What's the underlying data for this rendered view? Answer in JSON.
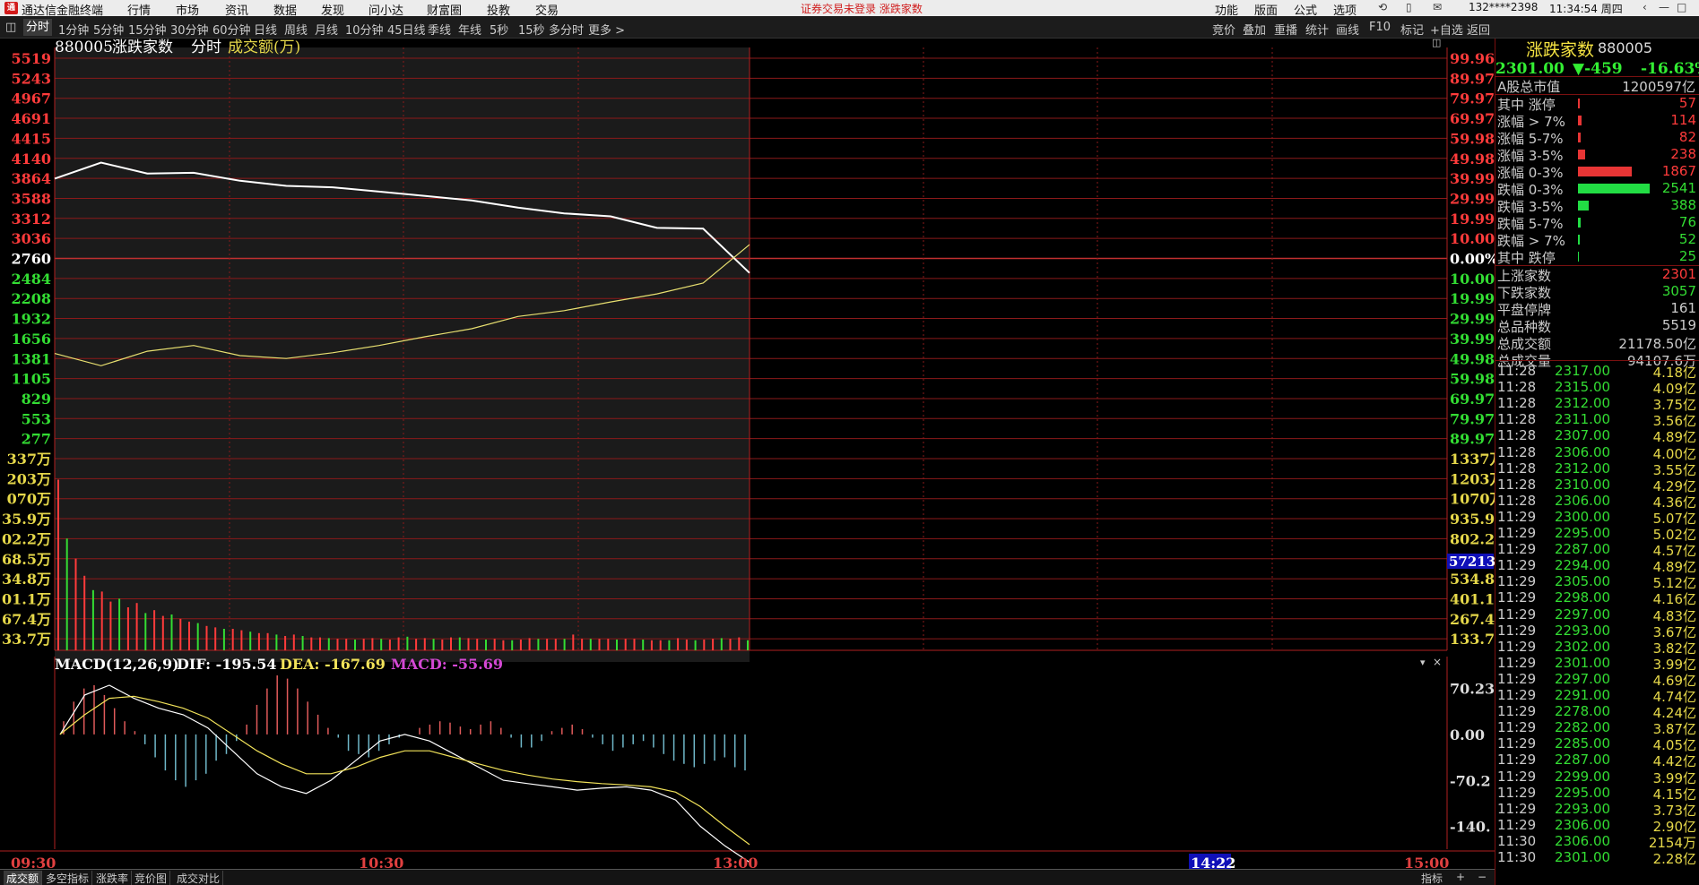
{
  "titlebar": {
    "app_name": "通达信金融终端",
    "menus": [
      "行情",
      "市场",
      "资讯",
      "数据",
      "发现",
      "问小达",
      "财富圈",
      "投教",
      "交易"
    ],
    "notice": "证券交易未登录  涨跌家数",
    "right_menus": [
      "功能",
      "版面",
      "公式",
      "选项"
    ],
    "account": "132****2398",
    "clock": "11:34:54 周四"
  },
  "toolbar": {
    "periods": [
      "分时",
      "1分钟",
      "5分钟",
      "15分钟",
      "30分钟",
      "60分钟",
      "日线",
      "周线",
      "月线",
      "10分钟",
      "45日线",
      "季线",
      "年线",
      "5秒",
      "15秒",
      "多分时",
      "更多 >"
    ],
    "active": "分时",
    "right_items": [
      "竞价",
      "叠加",
      "重播",
      "统计",
      "画线",
      "F10",
      "标记",
      "+自选",
      "返回"
    ]
  },
  "chart_header": {
    "code": "880005",
    "name": "涨跌家数",
    "period": "分时",
    "indicator": "成交额(万)"
  },
  "price_axis_left": [
    "5519",
    "5243",
    "4967",
    "4691",
    "4415",
    "4140",
    "3864",
    "3588",
    "3312",
    "3036",
    "2760",
    "2484",
    "2208",
    "1932",
    "1656",
    "1381",
    "1105",
    "829",
    "553",
    "277"
  ],
  "price_axis_right": [
    "99.96",
    "89.97",
    "79.97",
    "69.97",
    "59.98",
    "49.98",
    "39.99",
    "29.99",
    "19.99",
    "10.00",
    "0.00%",
    "10.00",
    "19.99",
    "29.99",
    "39.99",
    "49.98",
    "59.98",
    "69.97",
    "79.97",
    "89.97"
  ],
  "volume_axis_left": [
    "337万",
    "203万",
    "070万",
    "35.9万",
    "02.2万",
    "68.5万",
    "34.8万",
    "01.1万",
    "67.4万",
    "33.7万"
  ],
  "volume_axis_right": [
    "1337万",
    "1203万",
    "1070万",
    "935.9",
    "802.2",
    "668.5",
    "534.8",
    "401.1",
    "267.4",
    "133.7"
  ],
  "volume_cursor": "57213",
  "macd": {
    "label": "MACD(12,26,9)",
    "dif": "DIF: -195.54",
    "dea": "DEA: -167.69",
    "macd": "MACD: -55.69",
    "axis": [
      "70.23",
      "0.00",
      "-70.2",
      "-140."
    ]
  },
  "time_axis": [
    "09:30",
    "10:30",
    "13:00",
    "14:22",
    "15:00"
  ],
  "bottom_tabs": [
    "成交额",
    "多空指标",
    "涨跌率",
    "竞价图",
    "成交对比"
  ],
  "bottom_right": [
    "指标",
    "+",
    "−"
  ],
  "colors": {
    "up": "#ff3b3b",
    "down": "#33dd33",
    "grid": "#8b1a1a",
    "white_line": "#ffffff",
    "yellow_line": "#e8e070"
  },
  "chart_data": [
    {
      "type": "line",
      "title": "涨跌家数 分时",
      "x": [
        "09:30",
        "10:30",
        "13:00",
        "15:00"
      ],
      "ylim": [
        0,
        5519
      ],
      "series": [
        {
          "values": [
            3860,
            4080,
            3930,
            3940,
            3830,
            3760,
            3740,
            3680,
            3620,
            3560,
            3460,
            3380,
            3340,
            3180,
            3170,
            2560
          ]
        },
        {
          "values": [
            1450,
            1280,
            1480,
            1560,
            1420,
            1380,
            1460,
            1560,
            1680,
            1790,
            1960,
            2040,
            2160,
            2270,
            2420,
            2950
          ]
        }
      ]
    },
    {
      "type": "bar",
      "title": "成交额(万)",
      "ylim": [
        0,
        1337
      ],
      "values": [
        1190,
        780,
        640,
        520,
        420,
        410,
        340,
        360,
        300,
        330,
        260,
        280,
        240,
        250,
        220,
        200,
        190,
        170,
        160,
        150,
        150,
        140,
        130,
        120,
        120,
        110,
        100,
        110,
        100,
        90,
        90,
        85,
        80,
        80,
        75,
        80,
        85,
        80,
        75,
        90,
        95,
        80,
        85,
        80,
        75,
        90,
        90,
        85,
        80,
        75,
        80,
        70,
        70,
        75,
        85,
        80,
        80,
        80,
        80,
        110,
        80,
        80,
        80,
        80,
        75,
        80,
        80,
        75,
        70,
        70,
        70,
        85,
        75,
        70,
        75,
        80,
        85,
        80,
        90,
        70
      ]
    },
    {
      "type": "bar",
      "title": "MACD(12,26,9)",
      "ylim": [
        -175,
        105
      ],
      "values": [
        20,
        50,
        70,
        75,
        60,
        40,
        20,
        5,
        -15,
        -35,
        -55,
        -70,
        -80,
        -70,
        -60,
        -40,
        -30,
        -10,
        15,
        45,
        70,
        90,
        85,
        70,
        50,
        30,
        10,
        -5,
        -25,
        -30,
        -35,
        -25,
        -15,
        -5,
        0,
        10,
        15,
        20,
        18,
        12,
        8,
        15,
        20,
        10,
        -5,
        -20,
        -20,
        -10,
        5,
        10,
        15,
        8,
        -5,
        -15,
        -25,
        -20,
        -15,
        -10,
        -20,
        -30,
        -40,
        -45,
        -50,
        -45,
        -40,
        -35,
        -50,
        -55
      ],
      "series": [
        {
          "values": [
            0,
            60,
            75,
            55,
            40,
            30,
            10,
            -25,
            -60,
            -80,
            -90,
            -70,
            -40,
            -10,
            0,
            -10,
            -30,
            -50,
            -70,
            -75,
            -80,
            -85,
            -82,
            -80,
            -85,
            -100,
            -140,
            -170,
            -195
          ]
        },
        {
          "values": [
            0,
            30,
            55,
            58,
            50,
            40,
            25,
            0,
            -25,
            -45,
            -60,
            -60,
            -50,
            -35,
            -25,
            -25,
            -35,
            -45,
            -55,
            -62,
            -68,
            -72,
            -75,
            -77,
            -80,
            -88,
            -110,
            -140,
            -168
          ]
        }
      ]
    }
  ],
  "panel": {
    "title": "涨跌家数",
    "code": "880005",
    "price": "2301.00",
    "change": "▼-459",
    "pct": "-16.63%",
    "market_cap_label": "A股总市值",
    "market_cap": "1200597亿",
    "dist": [
      {
        "label": "其中 涨停",
        "value": "57",
        "bar": 2
      },
      {
        "label": "涨幅 > 7%",
        "value": "114",
        "bar": 4
      },
      {
        "label": "涨幅 5-7%",
        "value": "82",
        "bar": 3
      },
      {
        "label": "涨幅 3-5%",
        "value": "238",
        "bar": 8
      },
      {
        "label": "涨幅 0-3%",
        "value": "1867",
        "bar": 60
      },
      {
        "label": "跌幅 0-3%",
        "value": "2541",
        "bar": 80
      },
      {
        "label": "跌幅 3-5%",
        "value": "388",
        "bar": 12
      },
      {
        "label": "跌幅 5-7%",
        "value": "76",
        "bar": 3
      },
      {
        "label": "跌幅 > 7%",
        "value": "52",
        "bar": 2
      },
      {
        "label": "其中 跌停",
        "value": "25",
        "bar": 1
      }
    ],
    "stats": [
      {
        "label": "上涨家数",
        "value": "2301"
      },
      {
        "label": "下跌家数",
        "value": "3057"
      },
      {
        "label": "平盘停牌",
        "value": "161"
      },
      {
        "label": "总品种数",
        "value": "5519"
      },
      {
        "label": "总成交额",
        "value": "21178.50亿"
      },
      {
        "label": "总成交量",
        "value": "94107.6万"
      }
    ],
    "ticks": [
      [
        "11:28",
        "2317.00",
        "4.18亿"
      ],
      [
        "11:28",
        "2315.00",
        "4.09亿"
      ],
      [
        "11:28",
        "2312.00",
        "3.75亿"
      ],
      [
        "11:28",
        "2311.00",
        "3.56亿"
      ],
      [
        "11:28",
        "2307.00",
        "4.89亿"
      ],
      [
        "11:28",
        "2306.00",
        "4.00亿"
      ],
      [
        "11:28",
        "2312.00",
        "3.55亿"
      ],
      [
        "11:28",
        "2310.00",
        "4.29亿"
      ],
      [
        "11:28",
        "2306.00",
        "4.36亿"
      ],
      [
        "11:29",
        "2300.00",
        "5.07亿"
      ],
      [
        "11:29",
        "2295.00",
        "5.02亿"
      ],
      [
        "11:29",
        "2287.00",
        "4.57亿"
      ],
      [
        "11:29",
        "2294.00",
        "4.89亿"
      ],
      [
        "11:29",
        "2305.00",
        "5.12亿"
      ],
      [
        "11:29",
        "2298.00",
        "4.16亿"
      ],
      [
        "11:29",
        "2297.00",
        "4.83亿"
      ],
      [
        "11:29",
        "2293.00",
        "3.67亿"
      ],
      [
        "11:29",
        "2302.00",
        "3.82亿"
      ],
      [
        "11:29",
        "2301.00",
        "3.99亿"
      ],
      [
        "11:29",
        "2297.00",
        "4.69亿"
      ],
      [
        "11:29",
        "2291.00",
        "4.74亿"
      ],
      [
        "11:29",
        "2278.00",
        "4.24亿"
      ],
      [
        "11:29",
        "2282.00",
        "3.87亿"
      ],
      [
        "11:29",
        "2285.00",
        "4.05亿"
      ],
      [
        "11:29",
        "2287.00",
        "4.42亿"
      ],
      [
        "11:29",
        "2299.00",
        "3.99亿"
      ],
      [
        "11:29",
        "2295.00",
        "4.15亿"
      ],
      [
        "11:29",
        "2293.00",
        "3.73亿"
      ],
      [
        "11:29",
        "2306.00",
        "2.90亿"
      ],
      [
        "11:30",
        "2306.00",
        "2154万"
      ],
      [
        "11:30",
        "2301.00",
        "2.28亿"
      ]
    ]
  }
}
